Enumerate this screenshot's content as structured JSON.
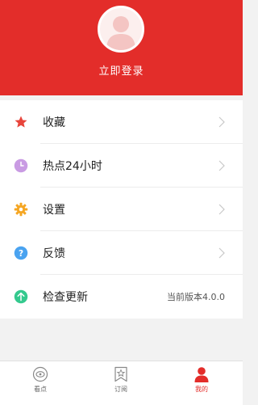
{
  "header": {
    "login_label": "立即登录",
    "background_color": "#e32d2a"
  },
  "menu": {
    "items": [
      {
        "label": "收藏",
        "icon": "star-icon",
        "icon_color": "#e8453c"
      },
      {
        "label": "热点24小时",
        "icon": "clock-icon",
        "icon_color": "#c99be3"
      },
      {
        "label": "设置",
        "icon": "gear-icon",
        "icon_color": "#f5a623"
      },
      {
        "label": "反馈",
        "icon": "question-icon",
        "icon_color": "#4aa3f0"
      },
      {
        "label": "检查更新",
        "icon": "upload-icon",
        "icon_color": "#34c98e",
        "value": "当前版本4.0.0"
      }
    ]
  },
  "tabbar": {
    "tabs": [
      {
        "label": "看点",
        "icon": "eye-icon",
        "active": false
      },
      {
        "label": "订阅",
        "icon": "bookmark-star-icon",
        "active": false
      },
      {
        "label": "我的",
        "icon": "user-icon",
        "active": true
      }
    ],
    "active_color": "#e32d2a"
  }
}
